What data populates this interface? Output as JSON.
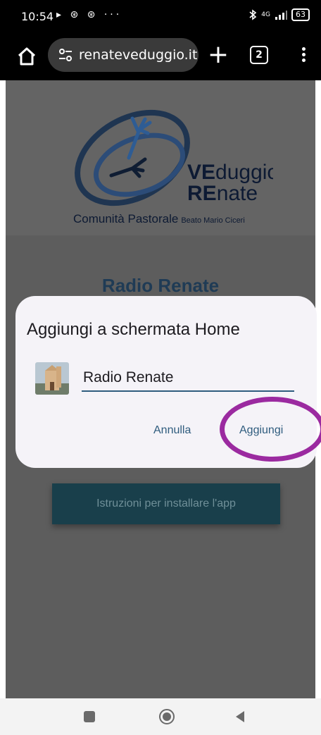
{
  "status_bar": {
    "time": "10:54",
    "left_icons": "▸ ⊛ ⊛ ···",
    "network": "4G",
    "battery": "63"
  },
  "browser": {
    "url": "renateveduggio.it",
    "tab_count": "2"
  },
  "page": {
    "logo": {
      "line1_bold": "VE",
      "line1_rest": "duggio",
      "line2_bold": "RE",
      "line2_rest": "nate",
      "line3_main": "Comunità Pastorale",
      "line3_small": "Beato Mario Ciceri"
    },
    "title": "Radio Renate",
    "install_button": "Istruzioni per installare l'app"
  },
  "dialog": {
    "title": "Aggiungi a schermata Home",
    "input_value": "Radio Renate",
    "cancel_label": "Annulla",
    "add_label": "Aggiungi"
  },
  "colors": {
    "highlight_circle": "#9b2aa0",
    "accent_text": "#2f5c7e",
    "page_title": "#1f3b55"
  }
}
